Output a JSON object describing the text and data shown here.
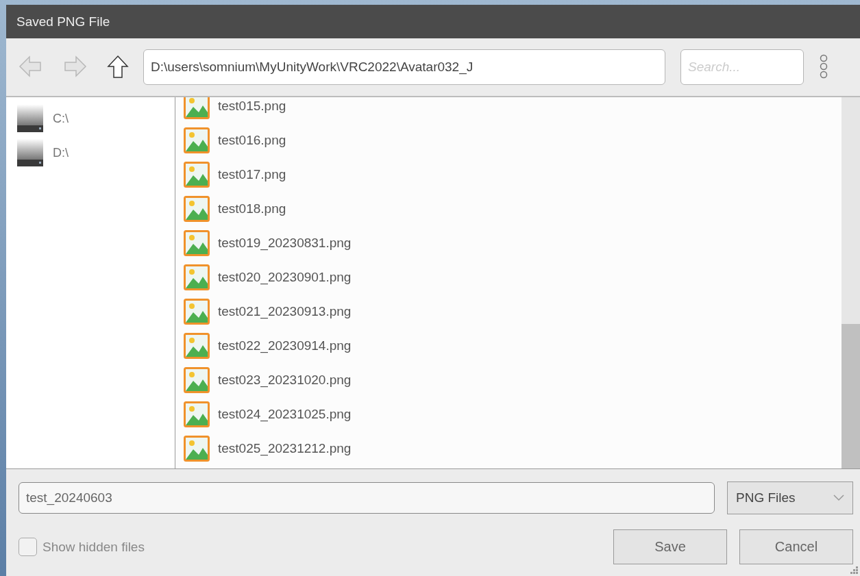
{
  "window": {
    "title": "Saved PNG File"
  },
  "toolbar": {
    "back": {
      "disabled": true
    },
    "forward": {
      "disabled": true
    },
    "path": "D:\\users\\somnium\\MyUnityWork\\VRC2022\\Avatar032_J",
    "search": {
      "placeholder": "Search..."
    }
  },
  "sidebar": {
    "items": [
      {
        "label": "C:\\",
        "selected": false
      },
      {
        "label": "D:\\",
        "selected": false
      }
    ]
  },
  "files": [
    {
      "name": "test015.png"
    },
    {
      "name": "test016.png"
    },
    {
      "name": "test017.png"
    },
    {
      "name": "test018.png"
    },
    {
      "name": "test019_20230831.png"
    },
    {
      "name": "test020_20230901.png"
    },
    {
      "name": "test021_20230913.png"
    },
    {
      "name": "test022_20230914.png"
    },
    {
      "name": "test023_20231020.png"
    },
    {
      "name": "test024_20231025.png"
    },
    {
      "name": "test025_20231212.png"
    }
  ],
  "filename": {
    "value": "test_20240603"
  },
  "filetype": {
    "value": "PNG Files"
  },
  "show_hidden": {
    "label": "Show hidden files",
    "checked": false
  },
  "buttons": [
    {
      "label": "Save"
    },
    {
      "label": "Cancel"
    }
  ]
}
